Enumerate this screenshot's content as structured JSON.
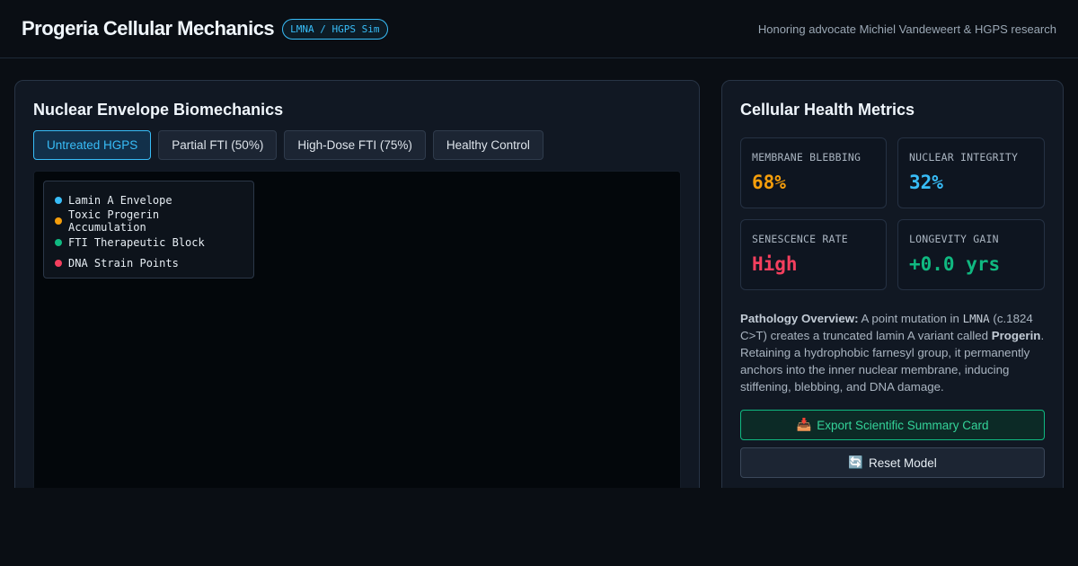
{
  "header": {
    "title": "Progeria Cellular Mechanics",
    "badge": "LMNA / HGPS Sim",
    "tagline": "Honoring advocate Michiel Vandeweert & HGPS research"
  },
  "left_panel": {
    "title": "Nuclear Envelope Biomechanics",
    "tabs": [
      {
        "label": "Untreated HGPS",
        "active": true
      },
      {
        "label": "Partial FTI (50%)",
        "active": false
      },
      {
        "label": "High-Dose FTI (75%)",
        "active": false
      },
      {
        "label": "Healthy Control",
        "active": false
      }
    ],
    "legend": [
      {
        "label": "Lamin A Envelope",
        "color": "#38bdf8"
      },
      {
        "label": "Toxic Progerin Accumulation",
        "color": "#f59e0b"
      },
      {
        "label": "FTI Therapeutic Block",
        "color": "#10b981"
      },
      {
        "label": "DNA Strain Points",
        "color": "#f43f5e"
      }
    ]
  },
  "right_panel": {
    "title": "Cellular Health Metrics",
    "metrics": [
      {
        "label": "MEMBRANE BLEBBING",
        "value": "68%",
        "color": "#f59e0b"
      },
      {
        "label": "NUCLEAR INTEGRITY",
        "value": "32%",
        "color": "#38bdf8"
      },
      {
        "label": "SENESCENCE RATE",
        "value": "High",
        "color": "#f43f5e"
      },
      {
        "label": "LONGEVITY GAIN",
        "value": "+0.0 yrs",
        "color": "#10b981"
      }
    ],
    "overview": {
      "heading": "Pathology Overview:",
      "text_1": " A point mutation in ",
      "gene": "LMNA",
      "text_2": " (c.1824 C>T) creates a truncated lamin A variant called ",
      "protein": "Progerin",
      "text_3": ". Retaining a hydrophobic farnesyl group, it permanently anchors into the inner nuclear membrane, inducing stiffening, blebbing, and DNA damage."
    },
    "export_button": {
      "icon": "📥",
      "label": "Export Scientific Summary Card"
    },
    "reset_button": {
      "icon": "🔄",
      "label": "Reset Model"
    }
  }
}
